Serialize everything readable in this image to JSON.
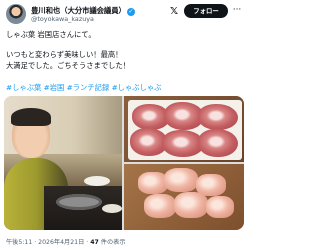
{
  "header": {
    "display_name": "豊川和也（大分市議会議員）",
    "handle": "@toyokawa_kazuya",
    "follow_label": "フォロー",
    "more_label": "···",
    "x_logo": "𝕏",
    "verified_glyph": "✓"
  },
  "tweet": {
    "text": "しゃぶ葉 岩国店さんにて。\n\nいつもと変わらず美味しい！最高！\n大満足でした。ごちそうさまでした！",
    "hashtags": "#しゃぶ葉 #岩国 #ランチ記録 #しゃぶしゃぶ"
  },
  "footer": {
    "timestamp": "午後5:11 · 2026年4月21日 · ",
    "views_count": "47",
    "views_label": " 件の表示"
  },
  "icons": {
    "avatar": "person-avatar",
    "verified": "verified-badge-icon",
    "x_logo": "x-logo-icon",
    "more": "more-icon"
  },
  "colors": {
    "accent": "#1d9bf0",
    "text": "#0f1419",
    "muted": "#536471",
    "follow_bg": "#0f1419"
  }
}
